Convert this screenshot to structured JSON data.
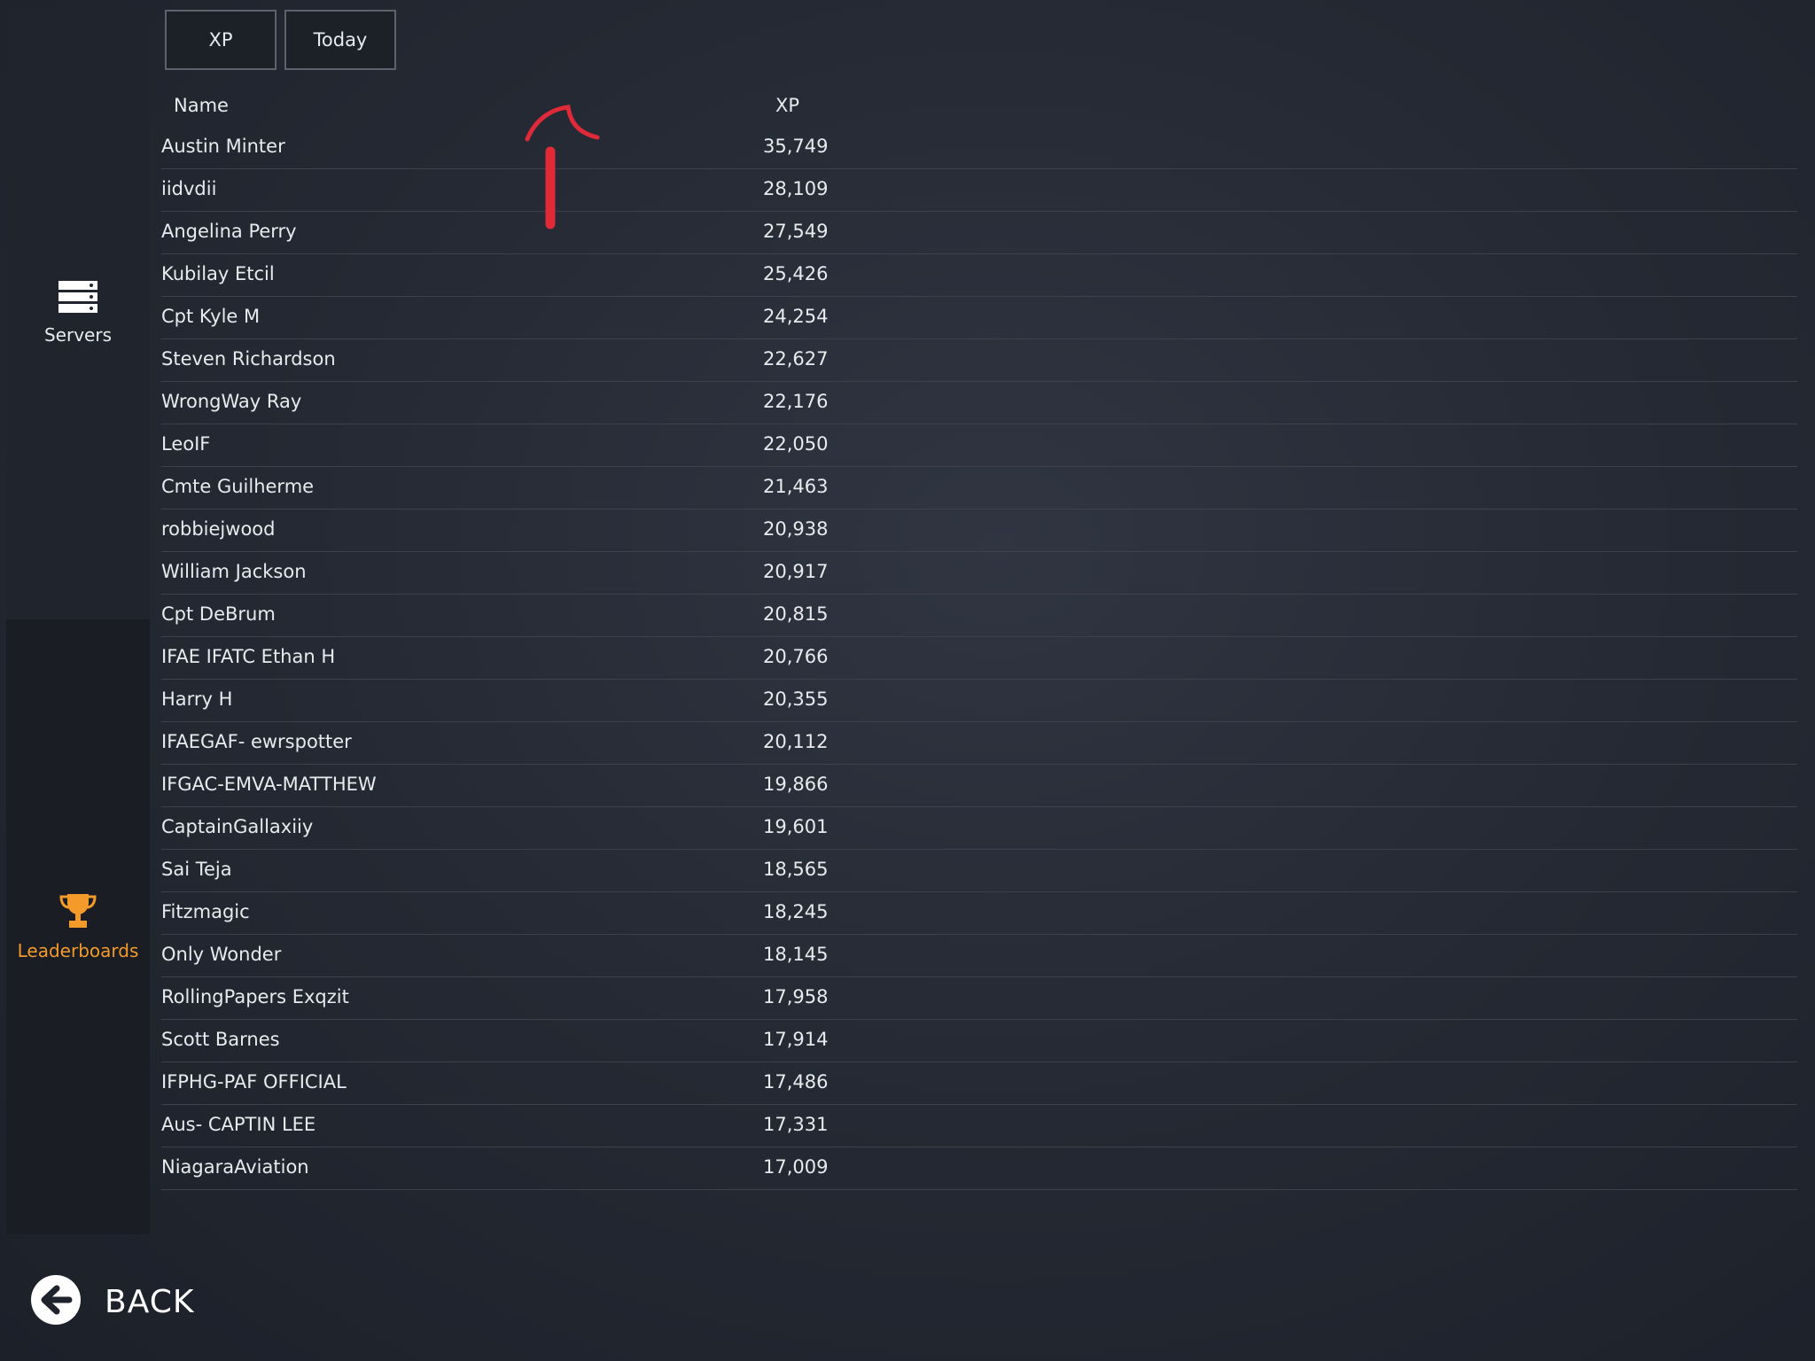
{
  "sidebar": {
    "servers": {
      "label": "Servers",
      "icon": "server-rack-icon"
    },
    "leaderboards": {
      "label": "Leaderboards",
      "icon": "trophy-icon",
      "active_color": "#f39a2a"
    }
  },
  "filters": {
    "metric": "XP",
    "period": "Today"
  },
  "table": {
    "headers": {
      "name": "Name",
      "xp": "XP"
    },
    "rows": [
      {
        "name": "Austin Minter",
        "xp": "35,749"
      },
      {
        "name": "iidvdii",
        "xp": "28,109"
      },
      {
        "name": "Angelina Perry",
        "xp": "27,549"
      },
      {
        "name": "Kubilay Etcil",
        "xp": "25,426"
      },
      {
        "name": "Cpt Kyle M",
        "xp": "24,254"
      },
      {
        "name": "Steven Richardson",
        "xp": "22,627"
      },
      {
        "name": "WrongWay Ray",
        "xp": "22,176"
      },
      {
        "name": "LeoIF",
        "xp": "22,050"
      },
      {
        "name": "Cmte Guilherme",
        "xp": "21,463"
      },
      {
        "name": "robbiejwood",
        "xp": "20,938"
      },
      {
        "name": "William Jackson",
        "xp": "20,917"
      },
      {
        "name": "Cpt DeBrum",
        "xp": "20,815"
      },
      {
        "name": "IFAE IFATC Ethan H",
        "xp": "20,766"
      },
      {
        "name": "Harry H",
        "xp": "20,355"
      },
      {
        "name": "IFAEGAF- ewrspotter",
        "xp": "20,112"
      },
      {
        "name": "IFGAC-EMVA-MATTHEW",
        "xp": "19,866"
      },
      {
        "name": "CaptainGallaxiiy",
        "xp": "19,601"
      },
      {
        "name": "Sai Teja",
        "xp": "18,565"
      },
      {
        "name": "Fitzmagic",
        "xp": "18,245"
      },
      {
        "name": "Only Wonder",
        "xp": "18,145"
      },
      {
        "name": "RollingPapers Exqzit",
        "xp": "17,958"
      },
      {
        "name": "Scott Barnes",
        "xp": "17,914"
      },
      {
        "name": "IFPHG-PAF OFFICIAL",
        "xp": "17,486"
      },
      {
        "name": "Aus- CAPTIN LEE",
        "xp": "17,331"
      },
      {
        "name": "NiagaraAviation",
        "xp": "17,009"
      }
    ]
  },
  "annotation": {
    "icon": "red-arrow-annotation",
    "color": "#e02a3a"
  },
  "back": {
    "label": "BACK",
    "icon": "back-arrow-icon"
  }
}
